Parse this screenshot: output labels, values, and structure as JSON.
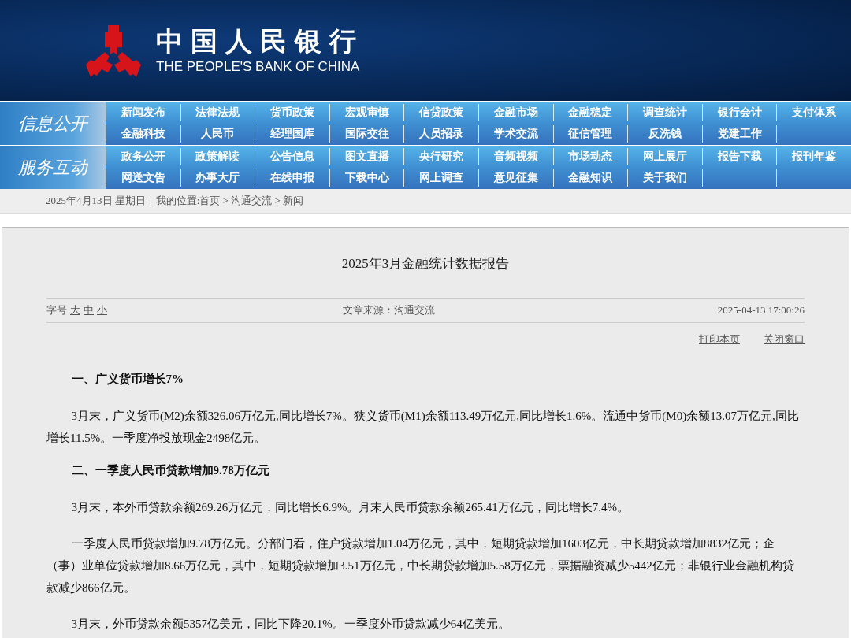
{
  "banner": {
    "title": "中国人民银行",
    "subtitle": "THE PEOPLE'S BANK OF CHINA"
  },
  "nav_sections": [
    {
      "label": "信息公开",
      "rows": [
        [
          "新闻发布",
          "法律法规",
          "货币政策",
          "宏观审慎",
          "信贷政策",
          "金融市场",
          "金融稳定",
          "调查统计",
          "银行会计",
          "支付体系"
        ],
        [
          "金融科技",
          "人民币",
          "经理国库",
          "国际交往",
          "人员招录",
          "学术交流",
          "征信管理",
          "反洗钱",
          "党建工作"
        ]
      ]
    },
    {
      "label": "服务互动",
      "rows": [
        [
          "政务公开",
          "政策解读",
          "公告信息",
          "图文直播",
          "央行研究",
          "音频视频",
          "市场动态",
          "网上展厅",
          "报告下载",
          "报刊年鉴"
        ],
        [
          "网送文告",
          "办事大厅",
          "在线申报",
          "下载中心",
          "网上调查",
          "意见征集",
          "金融知识",
          "关于我们"
        ]
      ]
    }
  ],
  "breadcrumb": {
    "date": "2025年4月13日 星期日",
    "location": "我的位置:首页 > 沟通交流 > 新闻"
  },
  "article": {
    "title": "2025年3月金融统计数据报告",
    "font_size_label": "字号",
    "font_sizes": [
      "大",
      "中",
      "小"
    ],
    "source": "文章来源：沟通交流",
    "timestamp": "2025-04-13 17:00:26",
    "actions": [
      "打印本页",
      "关闭窗口"
    ],
    "blocks": [
      {
        "kind": "heading",
        "text": "一、广义货币增长7%"
      },
      {
        "kind": "paragraph",
        "text": "3月末，广义货币(M2)余额326.06万亿元,同比增长7%。狭义货币(M1)余额113.49万亿元,同比增长1.6%。流通中货币(M0)余额13.07万亿元,同比增长11.5%。一季度净投放现金2498亿元。"
      },
      {
        "kind": "heading",
        "text": "二、一季度人民币贷款增加9.78万亿元"
      },
      {
        "kind": "paragraph",
        "text": "3月末，本外币贷款余额269.26万亿元，同比增长6.9%。月末人民币贷款余额265.41万亿元，同比增长7.4%。"
      },
      {
        "kind": "paragraph",
        "text": "一季度人民币贷款增加9.78万亿元。分部门看，住户贷款增加1.04万亿元，其中，短期贷款增加1603亿元，中长期贷款增加8832亿元；企（事）业单位贷款增加8.66万亿元，其中，短期贷款增加3.51万亿元，中长期贷款增加5.58万亿元，票据融资减少5442亿元；非银行业金融机构贷款减少866亿元。"
      },
      {
        "kind": "paragraph",
        "text": "3月末，外币贷款余额5357亿美元，同比下降20.1%。一季度外币贷款减少64亿美元。"
      }
    ]
  }
}
